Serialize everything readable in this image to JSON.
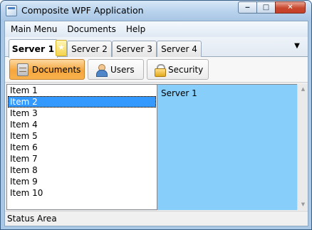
{
  "window": {
    "title": "Composite WPF Application"
  },
  "menu": {
    "items": [
      "Main Menu",
      "Documents",
      "Help"
    ]
  },
  "tabs": [
    "Server 1",
    "Server 2",
    "Server 3",
    "Server 4"
  ],
  "toolbar": {
    "buttons": [
      {
        "label": "Documents",
        "icon": "database-icon",
        "selected": true
      },
      {
        "label": "Users",
        "icon": "users-icon",
        "selected": false
      },
      {
        "label": "Security",
        "icon": "lock-icon",
        "selected": false
      }
    ]
  },
  "list": {
    "items": [
      "Item 1",
      "Item 2",
      "Item 3",
      "Item 4",
      "Item 5",
      "Item 6",
      "Item 7",
      "Item 8",
      "Item 9",
      "Item 10"
    ],
    "selected_index": 1
  },
  "detail": {
    "text": "Server 1"
  },
  "status": {
    "text": "Status Area"
  },
  "colors": {
    "detail_background": "#87cefa",
    "selection": "#3399ff",
    "toolbar_selected": "#f6a63c"
  }
}
